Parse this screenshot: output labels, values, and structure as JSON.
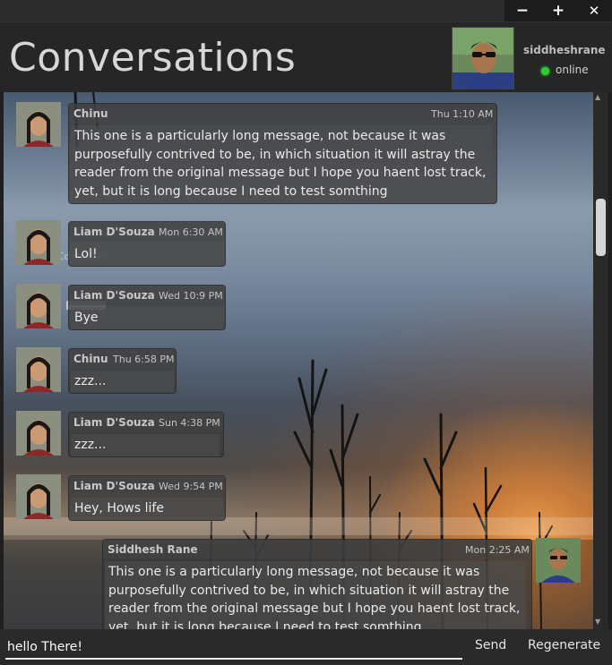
{
  "window": {
    "minimize": "−",
    "maximize": "+",
    "close": "✕"
  },
  "header": {
    "title": "Conversations",
    "user_name": "siddheshrane",
    "status": "online",
    "status_color": "#2ecc2e"
  },
  "messages": [
    {
      "name": "Chinu",
      "time": "Thu 1:10 AM",
      "text": [
        "This one is a particularly long message, not because it was",
        "purposefully contrived to be, in which situation it will astray the",
        "reader from the original message but I hope you haent lost track,",
        "yet, but it is long because I need to test somthing"
      ]
    },
    {
      "name": "Liam D'Souza",
      "time": "Mon 6:30 AM",
      "text": [
        "Lol!"
      ]
    },
    {
      "name": "Liam D'Souza",
      "time": "Wed 10:9 PM",
      "text": [
        "Bye"
      ]
    },
    {
      "name": "Chinu",
      "time": "Thu 6:58 PM",
      "text": [
        "zzz..."
      ]
    },
    {
      "name": "Liam D'Souza",
      "time": "Sun 4:38 PM",
      "text": [
        "zzz..."
      ]
    },
    {
      "name": "Liam D'Souza",
      "time": "Wed 9:54 PM",
      "text": [
        "Hey, Hows life"
      ]
    },
    {
      "name": "Siddhesh Rane",
      "time": "Mon 2:25 AM",
      "text": [
        "This one is a particularly long message, not because it was",
        "purposefully contrived to be, in which situation it will astray the",
        "reader from the original message but I hope you haent lost track,",
        "yet, but it is long because I need to test somthing"
      ]
    }
  ],
  "desktop": {
    "ghost_label": "Computer"
  },
  "input": {
    "value": "hello There!",
    "send": "Send",
    "regenerate": "Regenerate"
  }
}
